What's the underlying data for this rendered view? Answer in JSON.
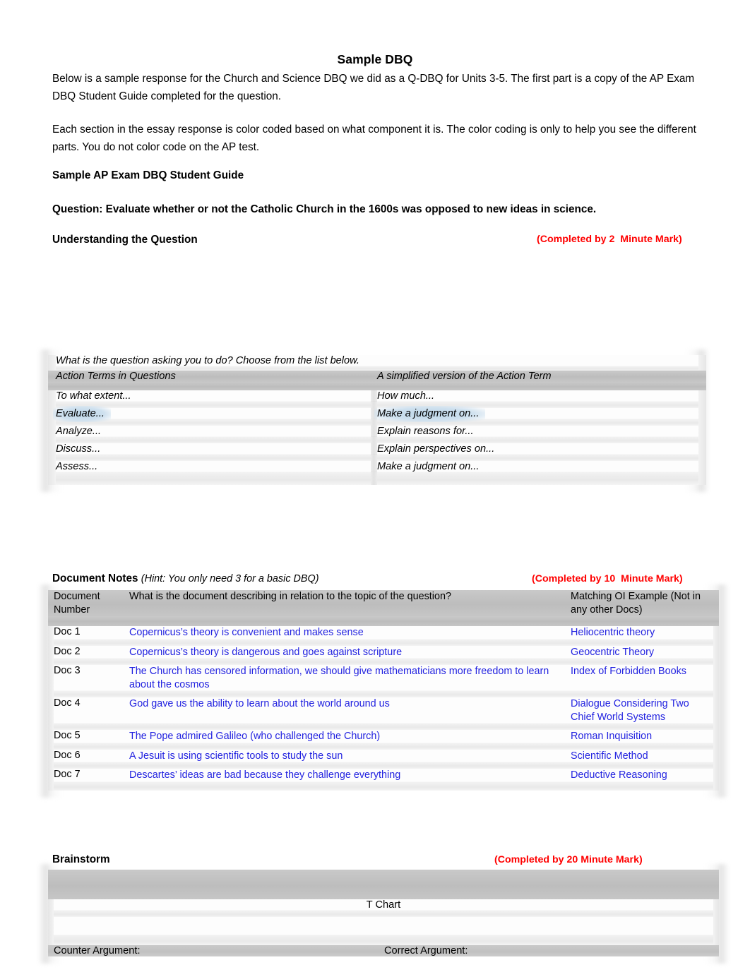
{
  "document": {
    "title": "Sample DBQ",
    "intro_paragraph_1": "Below is a sample response for the Church and Science DBQ we did as a Q-DBQ for Units 3-5. The first part is a copy of the AP Exam DBQ Student Guide completed for the question.",
    "intro_paragraph_2": "Each section in the essay response is color coded based on what component it is. The color coding is only to help you see the different parts. You do not color code on the AP test.",
    "guide_heading": "Sample AP Exam DBQ Student Guide",
    "question_line": "Question: Evaluate whether or not the Catholic Church in the 1600s was opposed to new ideas in science."
  },
  "colors": {
    "completed_mark": "#FF0000",
    "student_answer": "#2323E0",
    "highlight": "#CFE1EF",
    "table_header": "#C4C4C4"
  },
  "understanding": {
    "heading": "Understanding the Question",
    "completed_by": "(Completed by 2  Minute Mark)",
    "table": {
      "caption": "What is the question asking you to do? Choose from the list below.",
      "headers": [
        "Action Terms in Questions",
        "A simplified version of the Action Term"
      ],
      "rows": [
        {
          "term": "To what extent...",
          "simplified": "How much...",
          "highlighted": false
        },
        {
          "term": "Evaluate...",
          "simplified": "Make a judgment on...",
          "highlighted": true
        },
        {
          "term": "Analyze...",
          "simplified": "Explain reasons for...",
          "highlighted": false
        },
        {
          "term": "Discuss...",
          "simplified": "Explain perspectives on...",
          "highlighted": false
        },
        {
          "term": "Assess...",
          "simplified": "Make a judgment on...",
          "highlighted": false
        }
      ]
    }
  },
  "document_notes": {
    "heading": "Document Notes",
    "hint": "(Hint: You only need 3 for a basic DBQ)",
    "completed_by": "(Completed by 10  Minute Mark)",
    "headers": {
      "number": "Document Number",
      "description": "What is the document describing in relation to the topic of the question?",
      "oi": "Matching OI Example (Not in any other Docs)"
    },
    "rows": [
      {
        "number": "Doc 1",
        "description": "Copernicus’s theory is convenient and makes sense",
        "oi": "Heliocentric theory"
      },
      {
        "number": "Doc 2",
        "description": "Copernicus’s theory is dangerous and goes against scripture",
        "oi": "Geocentric Theory"
      },
      {
        "number": "Doc 3",
        "description": "The Church has censored information, we should give mathematicians more freedom to learn about the cosmos",
        "oi": "Index of Forbidden Books"
      },
      {
        "number": "Doc 4",
        "description": "God gave us the ability to learn about the world around us",
        "oi": "Dialogue Considering Two Chief World Systems"
      },
      {
        "number": "Doc 5",
        "description": "The Pope admired Galileo (who challenged the Church)",
        "oi": "Roman Inquisition"
      },
      {
        "number": "Doc 6",
        "description": "A Jesuit is using scientific tools to study the sun",
        "oi": "Scientific Method"
      },
      {
        "number": "Doc 7",
        "description": "Descartes’ ideas are bad because they challenge everything",
        "oi": "Deductive Reasoning"
      }
    ]
  },
  "brainstorm": {
    "heading": "Brainstorm",
    "completed_by": "(Completed by 20 Minute Mark)",
    "t_chart_title": "T Chart",
    "counter_argument_label": "Counter Argument:",
    "correct_argument_label": "Correct Argument:"
  }
}
